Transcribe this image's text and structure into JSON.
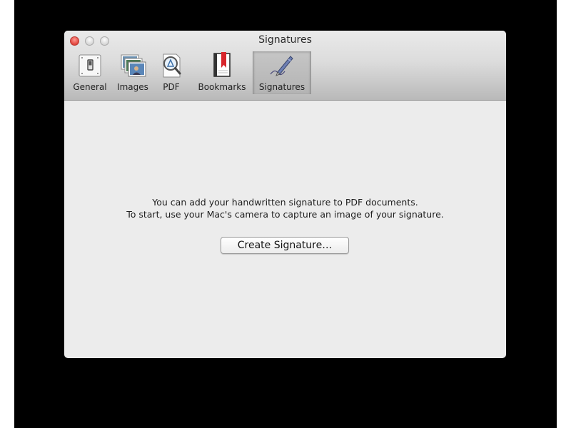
{
  "window": {
    "title": "Signatures",
    "buttons": {
      "close_color": "#e0443c",
      "minimize_color": "#d6d6d6",
      "zoom_color": "#d6d6d6"
    }
  },
  "tabs": [
    {
      "label": "General",
      "icon": "switch-icon",
      "selected": false
    },
    {
      "label": "Images",
      "icon": "photos-icon",
      "selected": false
    },
    {
      "label": "PDF",
      "icon": "pdf-magnifier-icon",
      "selected": false
    },
    {
      "label": "Bookmarks",
      "icon": "bookmark-icon",
      "selected": false
    },
    {
      "label": "Signatures",
      "icon": "pen-signature-icon",
      "selected": true
    }
  ],
  "content": {
    "message_line1": "You can add your handwritten signature to PDF documents.",
    "message_line2": "To start, use your Mac's camera to capture an image of your signature.",
    "create_button_label": "Create Signature…"
  }
}
